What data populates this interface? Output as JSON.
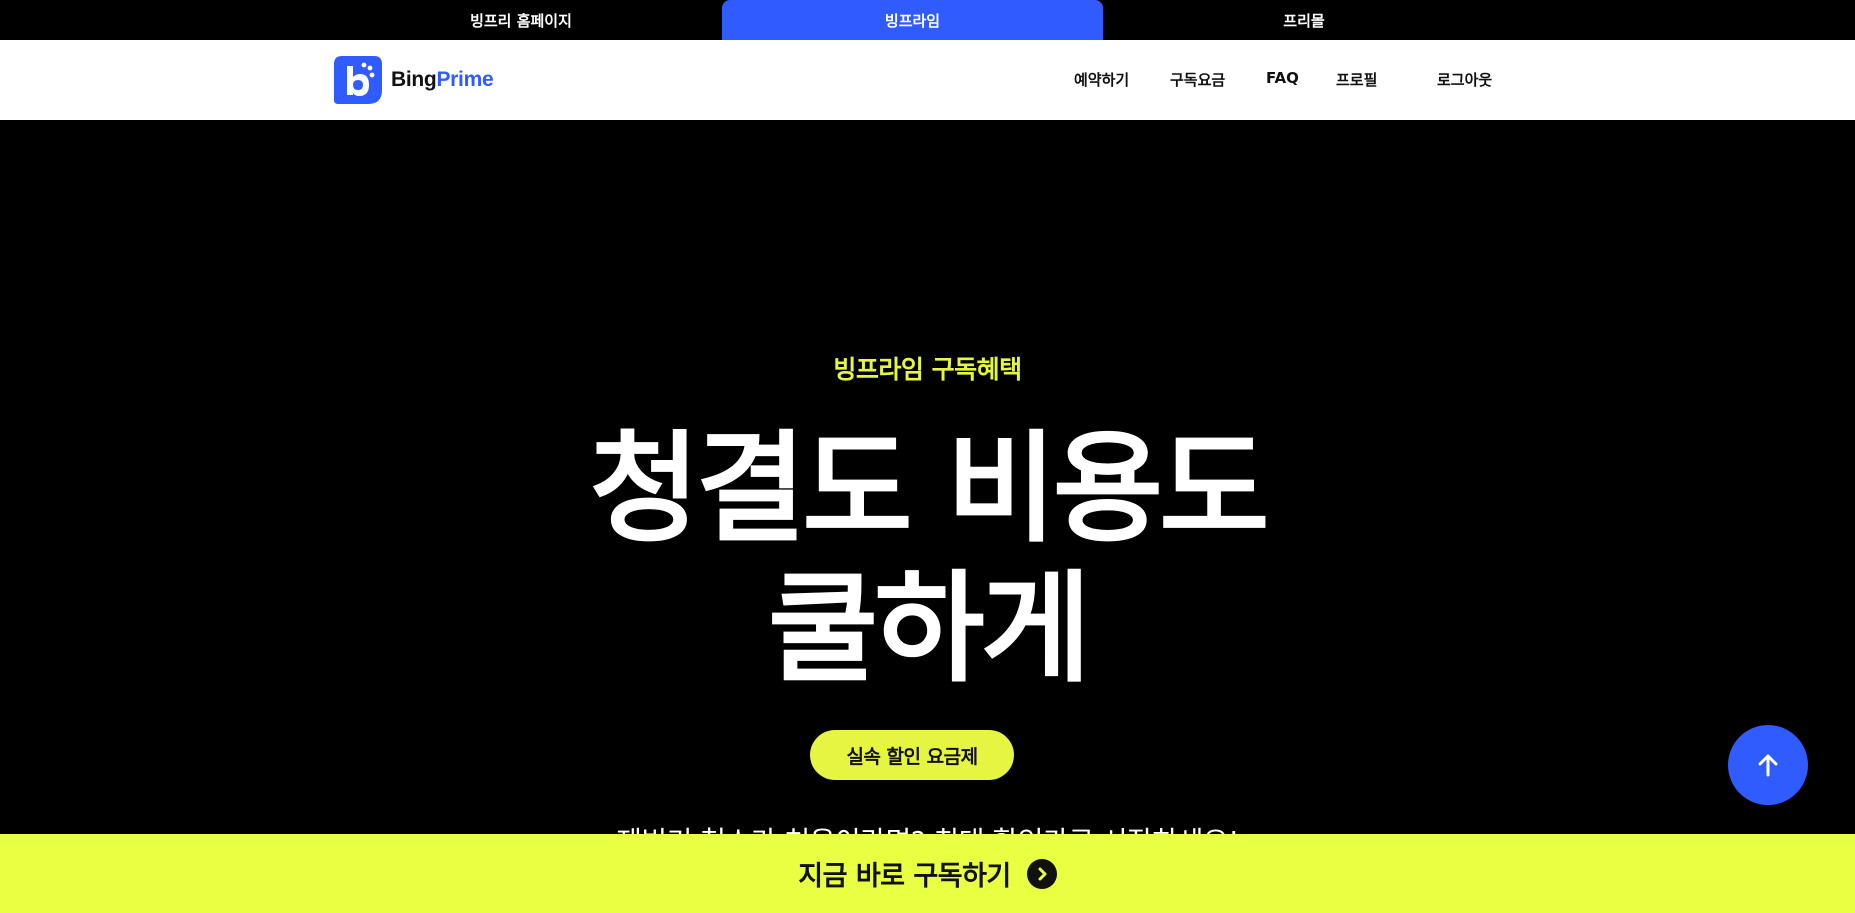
{
  "site_tabs": [
    {
      "label": "빙프리 홈페이지"
    },
    {
      "label": "빙프라임"
    },
    {
      "label": "프리몰"
    }
  ],
  "header": {
    "logo": {
      "text_main": "Bing",
      "text_accent": "Prime"
    },
    "nav": [
      {
        "label": "예약하기"
      },
      {
        "label": "구독요금"
      },
      {
        "label": "FAQ"
      },
      {
        "label": "프로필"
      },
      {
        "label": "로그아웃"
      }
    ]
  },
  "hero": {
    "eyebrow": "빙프라임 구독혜택",
    "headline_line1": "청결도 비용도",
    "headline_line2": "쿨하게",
    "pill": "실속 할인 요금제",
    "description": "제빙기 청소가 처음이라면? 최대 할인가로 시작하세요!"
  },
  "cta": {
    "label": "지금 바로 구독하기"
  },
  "colors": {
    "accent_blue": "#2f5bff",
    "accent_yellow": "#e6f542",
    "cta_yellow": "#e9ff42"
  },
  "icons": {
    "scroll_top": "arrow-up-icon",
    "cta": "chevron-right-circle-icon"
  }
}
